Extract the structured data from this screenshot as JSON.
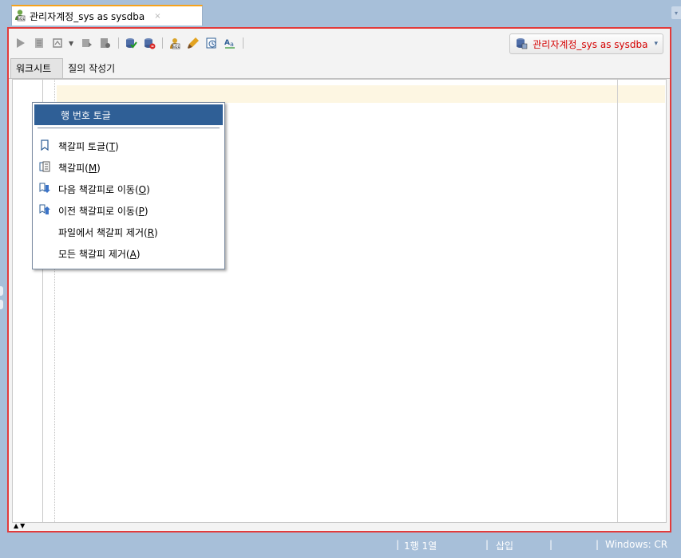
{
  "tab": {
    "title": "관리자계정_sys as sysdba",
    "close": "×",
    "icon": "sql-worksheet-icon"
  },
  "toolbar": {
    "buttons": [
      "run-statement-icon",
      "run-script-icon",
      "autotrace-icon",
      "explain-plan-icon",
      "sql-tuning-icon",
      "commit-icon",
      "rollback-icon",
      "unshared-worksheet-icon",
      "clear-icon",
      "sql-history-icon",
      "format-icon"
    ],
    "connection": {
      "label": "관리자계정_sys as sysdba",
      "arrow": "▾"
    }
  },
  "subtabs": {
    "worksheet": "워크시트",
    "query_builder": "질의 작성기"
  },
  "context_menu": {
    "items": [
      {
        "label": "행 번호 토글",
        "highlighted": true
      },
      {
        "label": "책갈피 토글",
        "mnemonic": "T",
        "icon": "bookmark-icon"
      },
      {
        "label": "책갈피",
        "mnemonic": "M",
        "icon": "bookmarks-list-icon"
      },
      {
        "label": "다음 책갈피로 이동",
        "mnemonic": "O",
        "icon": "next-bookmark-icon"
      },
      {
        "label": "이전 책갈피로 이동",
        "mnemonic": "P",
        "icon": "previous-bookmark-icon"
      },
      {
        "label": "파일에서 책갈피 제거",
        "mnemonic": "R"
      },
      {
        "label": "모든 책갈피 제거",
        "mnemonic": "A"
      }
    ]
  },
  "status_bar": {
    "position": "1행 1열",
    "mode": "삽입",
    "empty": "",
    "platform": "Windows: CR"
  },
  "colors": {
    "accent_red": "#e23b3b",
    "chrome_blue": "#a7bfd9",
    "menu_highlight": "#2f5f96"
  }
}
